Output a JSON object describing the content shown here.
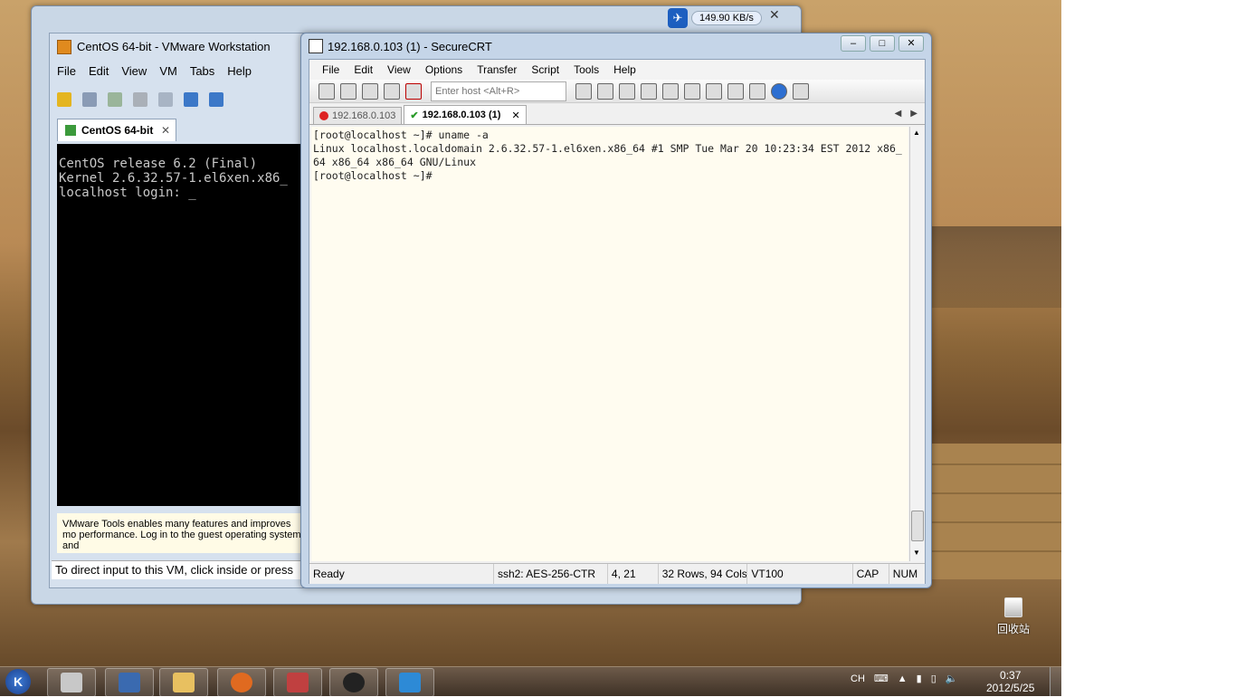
{
  "vmware": {
    "title": "CentOS 64-bit - VMware Workstation",
    "menu": [
      "File",
      "Edit",
      "View",
      "VM",
      "Tabs",
      "Help"
    ],
    "tab_label": "CentOS 64-bit",
    "console_lines": [
      "CentOS release 6.2 (Final)",
      "Kernel 2.6.32.57-1.el6xen.x86_",
      "",
      "localhost login: _"
    ],
    "tools_hint": "VMware Tools enables many features and improves mo performance. Log in to the guest operating system and",
    "status_text": "To direct input to this VM, click inside or press"
  },
  "net_speed": {
    "value": "149.90 KB/s"
  },
  "securecrt": {
    "title": "192.168.0.103 (1) - SecureCRT",
    "menu": [
      "File",
      "Edit",
      "View",
      "Options",
      "Transfer",
      "Script",
      "Tools",
      "Help"
    ],
    "host_placeholder": "Enter host <Alt+R>",
    "tabs": [
      {
        "label": "192.168.0.103",
        "status": "error"
      },
      {
        "label": "192.168.0.103 (1)",
        "status": "connected"
      }
    ],
    "terminal_lines": [
      "[root@localhost ~]# uname -a",
      "Linux localhost.localdomain 2.6.32.57-1.el6xen.x86_64 #1 SMP Tue Mar 20 10:23:34 EST 2012 x86_",
      "64 x86_64 x86_64 GNU/Linux",
      "[root@localhost ~]#"
    ],
    "status": {
      "ready": "Ready",
      "cipher": "ssh2: AES-256-CTR",
      "cursor": "4, 21",
      "size": "32 Rows, 94 Cols",
      "emulation": "VT100",
      "caps": "CAP",
      "num": "NUM"
    }
  },
  "desktop": {
    "recycle_bin_label": "回收站"
  },
  "taskbar": {
    "lang": "CH",
    "time": "0:37",
    "date": "2012/5/25"
  }
}
